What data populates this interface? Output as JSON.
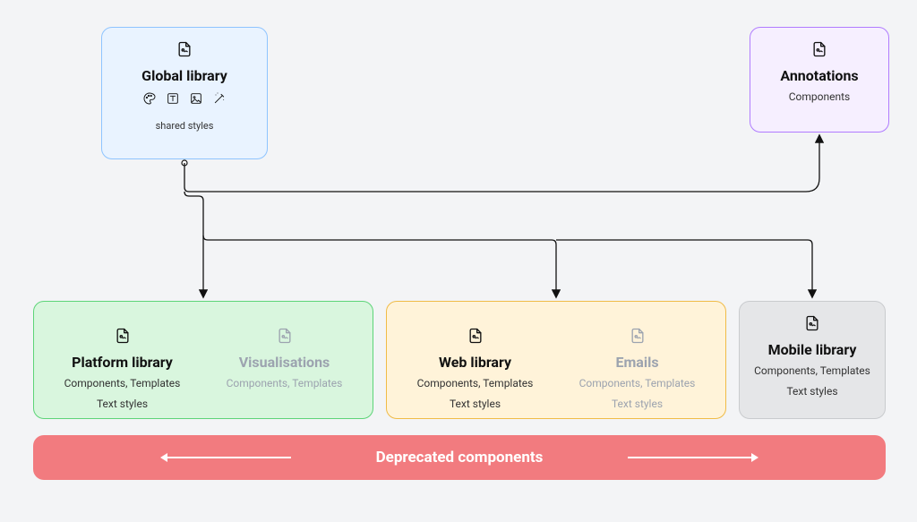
{
  "global": {
    "title": "Global library",
    "styles": "shared styles"
  },
  "annotations": {
    "title": "Annotations",
    "sub": "Components"
  },
  "platform": {
    "title": "Platform library",
    "sub1": "Components, Templates",
    "sub2": "Text styles"
  },
  "visualisations": {
    "title": "Visualisations",
    "sub": "Components, Templates"
  },
  "web": {
    "title": "Web library",
    "sub1": "Components, Templates",
    "sub2": "Text styles"
  },
  "emails": {
    "title": "Emails",
    "sub1": "Components, Templates",
    "sub2": "Text styles"
  },
  "mobile": {
    "title": "Mobile library",
    "sub1": "Components, Templates",
    "sub2": "Text styles"
  },
  "deprecated": "Deprecated components"
}
